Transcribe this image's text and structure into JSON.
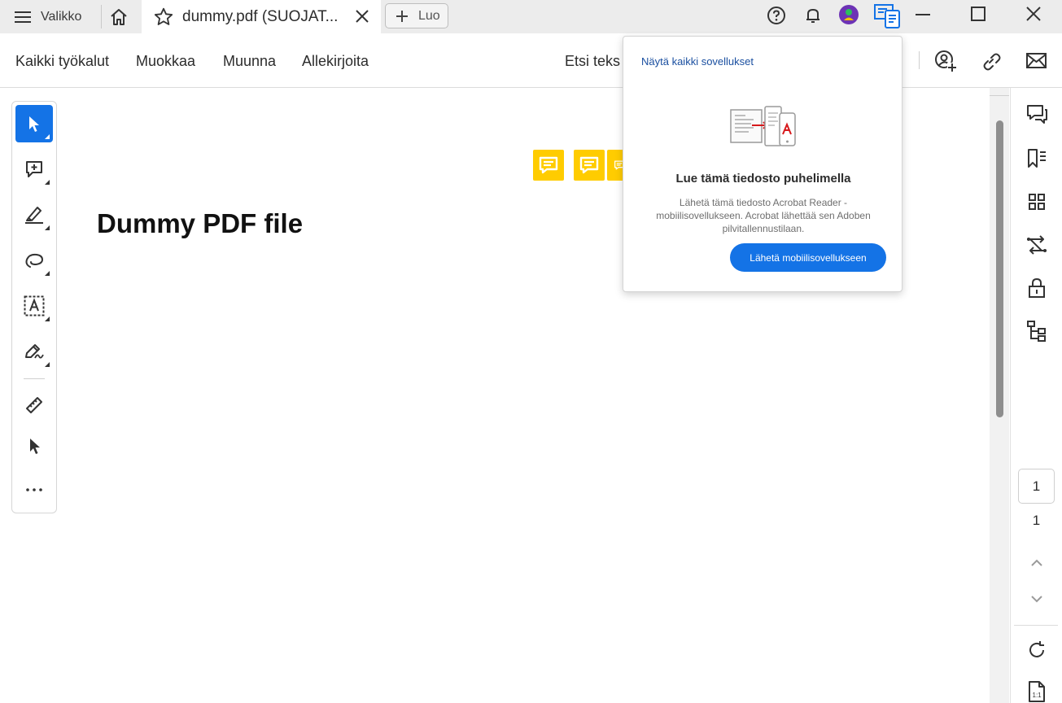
{
  "titlebar": {
    "menu_label": "Valikko",
    "tab_title": "dummy.pdf (SUOJAT...",
    "new_tab_label": "Luo"
  },
  "toolbar": {
    "all_tools": "Kaikki työkalut",
    "edit": "Muokkaa",
    "convert": "Muunna",
    "sign": "Allekirjoita",
    "find_text": "Etsi teks"
  },
  "document": {
    "title": "Dummy PDF file"
  },
  "popup": {
    "show_all_apps": "Näytä kaikki sovellukset",
    "heading": "Lue tämä tiedosto puhelimella",
    "description": "Lähetä tämä tiedosto Acrobat Reader -mobiilisovellukseen. Acrobat lähettää sen Adoben pilvitallennustilaan.",
    "button_label": "Lähetä mobiilisovellukseen"
  },
  "pager": {
    "current_page": "1",
    "total_pages": "1"
  },
  "colors": {
    "accent": "#1473e6",
    "note": "#ffcc00"
  }
}
